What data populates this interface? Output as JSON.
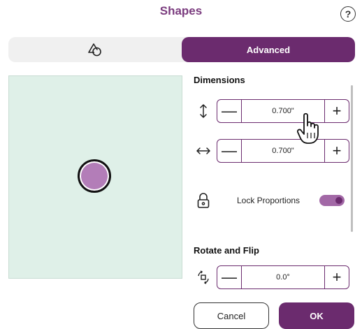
{
  "dialog": {
    "title": "Shapes",
    "help_glyph": "?"
  },
  "tabs": [
    {
      "label": "",
      "icon": "shapes-icon",
      "active": false
    },
    {
      "label": "Advanced",
      "active": true
    }
  ],
  "canvas": {
    "background": "#dff0e8",
    "shape_fill": "#b37db8",
    "shape_type": "circle"
  },
  "dimensions": {
    "title": "Dimensions",
    "height": {
      "icon": "vertical-resize-icon",
      "value": "0.700\""
    },
    "width": {
      "icon": "horizontal-resize-icon",
      "value": "0.700\""
    },
    "lock": {
      "label": "Lock Proportions",
      "enabled": true,
      "icon": "lock-icon"
    }
  },
  "rotate": {
    "title": "Rotate and Flip",
    "icon": "rotate-flip-icon",
    "value": "0.0°"
  },
  "footer": {
    "cancel_label": "Cancel",
    "ok_label": "OK"
  },
  "colors": {
    "accent": "#6b2b6e",
    "title": "#7a3b7e",
    "toggle_track": "#a268a6"
  }
}
